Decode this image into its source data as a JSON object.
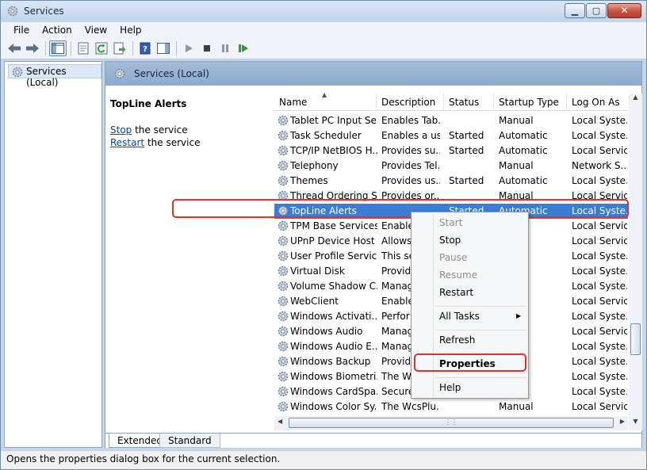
{
  "window": {
    "title": "Services"
  },
  "menubar": [
    "File",
    "Action",
    "View",
    "Help"
  ],
  "tree": {
    "root": "Services (Local)"
  },
  "panel": {
    "header": "Services (Local)"
  },
  "detail": {
    "service_name": "TopLine Alerts",
    "stop_link": "Stop",
    "stop_suffix": " the service",
    "restart_link": "Restart",
    "restart_suffix": " the service"
  },
  "columns": [
    "Name",
    "Description",
    "Status",
    "Startup Type",
    "Log On As"
  ],
  "rows": [
    {
      "name": "Tablet PC Input Se...",
      "desc": "Enables Tab...",
      "status": "",
      "startup": "Manual",
      "logon": "Local Syste..."
    },
    {
      "name": "Task Scheduler",
      "desc": "Enables a us...",
      "status": "Started",
      "startup": "Automatic",
      "logon": "Local Syste..."
    },
    {
      "name": "TCP/IP NetBIOS H...",
      "desc": "Provides su...",
      "status": "Started",
      "startup": "Automatic",
      "logon": "Local Service"
    },
    {
      "name": "Telephony",
      "desc": "Provides Tel...",
      "status": "",
      "startup": "Manual",
      "logon": "Network S..."
    },
    {
      "name": "Themes",
      "desc": "Provides us...",
      "status": "Started",
      "startup": "Automatic",
      "logon": "Local Syste..."
    },
    {
      "name": "Thread Ordering S...",
      "desc": "Provides or...",
      "status": "",
      "startup": "Manual",
      "logon": "Local Service"
    },
    {
      "name": "TopLine Alerts",
      "desc": "",
      "status": "Started",
      "startup": "Automatic",
      "logon": "Local Syste..."
    },
    {
      "name": "TPM Base Services",
      "desc": "Enable",
      "status": "",
      "startup": "",
      "logon": "Local Service"
    },
    {
      "name": "UPnP Device Host",
      "desc": "Allows",
      "status": "",
      "startup": "",
      "logon": "Local Service"
    },
    {
      "name": "User Profile Service",
      "desc": "This se",
      "status": "",
      "startup": "atic",
      "logon": "Local Syste..."
    },
    {
      "name": "Virtual Disk",
      "desc": "Provide",
      "status": "",
      "startup": "",
      "logon": "Local Syste..."
    },
    {
      "name": "Volume Shadow C...",
      "desc": "Manag",
      "status": "",
      "startup": "",
      "logon": "Local Syste..."
    },
    {
      "name": "WebClient",
      "desc": "Enable",
      "status": "",
      "startup": "",
      "logon": "Local Service"
    },
    {
      "name": "Windows Activati...",
      "desc": "Perfor",
      "status": "",
      "startup": "",
      "logon": "Local Syste..."
    },
    {
      "name": "Windows Audio",
      "desc": "Manag",
      "status": "",
      "startup": "atic",
      "logon": "Local Service"
    },
    {
      "name": "Windows Audio E...",
      "desc": "Manag",
      "status": "",
      "startup": "atic",
      "logon": "Local Syste..."
    },
    {
      "name": "Windows Backup",
      "desc": "Provide",
      "status": "",
      "startup": "",
      "logon": "Local Syste..."
    },
    {
      "name": "Windows Biometri...",
      "desc": "The Wi",
      "status": "",
      "startup": "",
      "logon": "Local Syste..."
    },
    {
      "name": "Windows CardSpa...",
      "desc": "Secure",
      "status": "",
      "startup": "",
      "logon": "Local Syste..."
    },
    {
      "name": "Windows Color Sy...",
      "desc": "The WcsPlu...",
      "status": "",
      "startup": "Manual",
      "logon": "Local Service"
    }
  ],
  "selected_row": 6,
  "context_menu": [
    {
      "label": "Start",
      "disabled": true
    },
    {
      "label": "Stop",
      "disabled": false
    },
    {
      "label": "Pause",
      "disabled": true
    },
    {
      "label": "Resume",
      "disabled": true
    },
    {
      "label": "Restart",
      "disabled": false
    },
    {
      "label": "All Tasks",
      "disabled": false,
      "submenu": true
    },
    {
      "label": "Refresh",
      "disabled": false
    },
    {
      "label": "Properties",
      "disabled": false,
      "bold": true
    },
    {
      "label": "Help",
      "disabled": false
    }
  ],
  "tabs": [
    "Extended",
    "Standard"
  ],
  "status_text": "Opens the properties dialog box for the current selection.",
  "colors": {
    "selection": "#3b7cd4",
    "highlight_box": "#e4302e",
    "header_bg": "#9bb5d5"
  }
}
